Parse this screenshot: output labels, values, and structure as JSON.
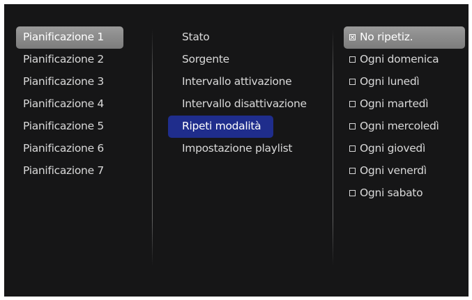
{
  "schedules": [
    {
      "label": "Pianificazione 1",
      "selected": true
    },
    {
      "label": "Pianificazione 2",
      "selected": false
    },
    {
      "label": "Pianificazione 3",
      "selected": false
    },
    {
      "label": "Pianificazione 4",
      "selected": false
    },
    {
      "label": "Pianificazione 5",
      "selected": false
    },
    {
      "label": "Pianificazione 6",
      "selected": false
    },
    {
      "label": "Pianificazione 7",
      "selected": false
    }
  ],
  "settings": [
    {
      "label": "Stato"
    },
    {
      "label": "Sorgente"
    },
    {
      "label": "Intervallo attivazione"
    },
    {
      "label": "Intervallo disattivazione"
    },
    {
      "label": "Ripeti modalità",
      "highlighted": true
    },
    {
      "label": "Impostazione playlist"
    }
  ],
  "repeat_options": [
    {
      "label": "No ripetiz.",
      "checked": true
    },
    {
      "label": "Ogni domenica",
      "checked": false
    },
    {
      "label": "Ogni lunedì",
      "checked": false
    },
    {
      "label": "Ogni martedì",
      "checked": false
    },
    {
      "label": "Ogni mercoledì",
      "checked": false
    },
    {
      "label": "Ogni giovedì",
      "checked": false
    },
    {
      "label": "Ogni venerdì",
      "checked": false
    },
    {
      "label": "Ogni sabato",
      "checked": false
    }
  ],
  "colors": {
    "background": "#161617",
    "highlight_blue": "#1f2d8c",
    "selection_grey": "#8a8a8a",
    "text": "#d9d9d9"
  }
}
